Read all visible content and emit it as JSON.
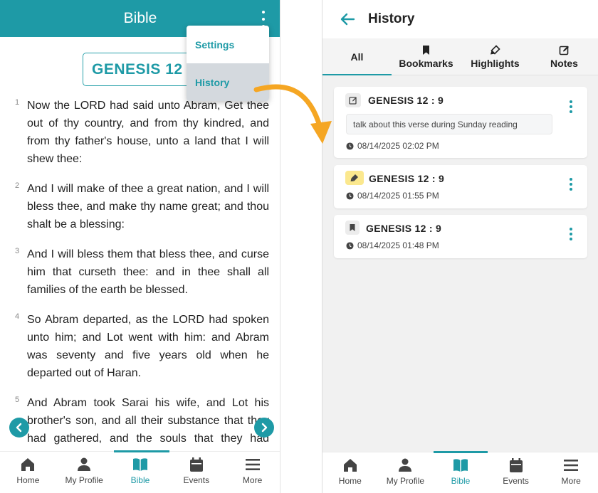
{
  "left_screen": {
    "appbar_title": "Bible",
    "chapter_label": "GENESIS 12",
    "menu": {
      "items": [
        {
          "label": "Settings"
        },
        {
          "label": "History"
        }
      ],
      "active_item": "History"
    },
    "verses": [
      {
        "num": "1",
        "text": "Now the LORD had said unto Abram, Get thee out of thy country, and from thy kindred, and from thy father's house, unto a land that I will shew thee:"
      },
      {
        "num": "2",
        "text": "And I will make of thee a great nation, and I will bless thee, and make thy name great; and thou shalt be a blessing:"
      },
      {
        "num": "3",
        "text": "And I will bless them that bless thee, and curse him that curseth thee: and in thee shall all families of the earth be blessed."
      },
      {
        "num": "4",
        "text": "So Abram departed, as the LORD had spoken unto him; and Lot went with him: and Abram was seventy and five years old when he departed out of Haran."
      },
      {
        "num": "5",
        "text": "And Abram took Sarai his wife, and Lot his brother's son, and all their substance that they had gathered, and the souls that they had gotten in Haran; and they went forth to go into"
      }
    ],
    "bottom_nav": [
      {
        "label": "Home",
        "icon": "home-icon"
      },
      {
        "label": "My Profile",
        "icon": "person-icon"
      },
      {
        "label": "Bible",
        "icon": "book-icon",
        "active": true
      },
      {
        "label": "Events",
        "icon": "calendar-icon"
      },
      {
        "label": "More",
        "icon": "menu-icon"
      }
    ]
  },
  "right_screen": {
    "header_title": "History",
    "tabs": [
      {
        "label": "All",
        "icon": "",
        "active": true
      },
      {
        "label": "Bookmarks",
        "icon": "bookmark-icon"
      },
      {
        "label": "Highlights",
        "icon": "highlighter-icon"
      },
      {
        "label": "Notes",
        "icon": "edit-note-icon"
      }
    ],
    "history_items": [
      {
        "type": "note",
        "icon": "edit-note-icon",
        "reference": "GENESIS 12 : 9",
        "note": "talk about this verse during Sunday reading",
        "time": "08/14/2025 02:02 PM"
      },
      {
        "type": "highlight",
        "icon": "highlighter-icon",
        "reference": "GENESIS 12 : 9",
        "time": "08/14/2025 01:55 PM"
      },
      {
        "type": "bookmark",
        "icon": "bookmark-icon",
        "reference": "GENESIS 12 : 9",
        "time": "08/14/2025 01:48 PM"
      }
    ],
    "bottom_nav": [
      {
        "label": "Home",
        "icon": "home-icon"
      },
      {
        "label": "My Profile",
        "icon": "person-icon"
      },
      {
        "label": "Bible",
        "icon": "book-icon",
        "active": true
      },
      {
        "label": "Events",
        "icon": "calendar-icon"
      },
      {
        "label": "More",
        "icon": "menu-icon"
      }
    ]
  },
  "colors": {
    "primary": "#1e9aa6",
    "arrow": "#f5a623",
    "highlight_badge": "#fbe88e"
  }
}
